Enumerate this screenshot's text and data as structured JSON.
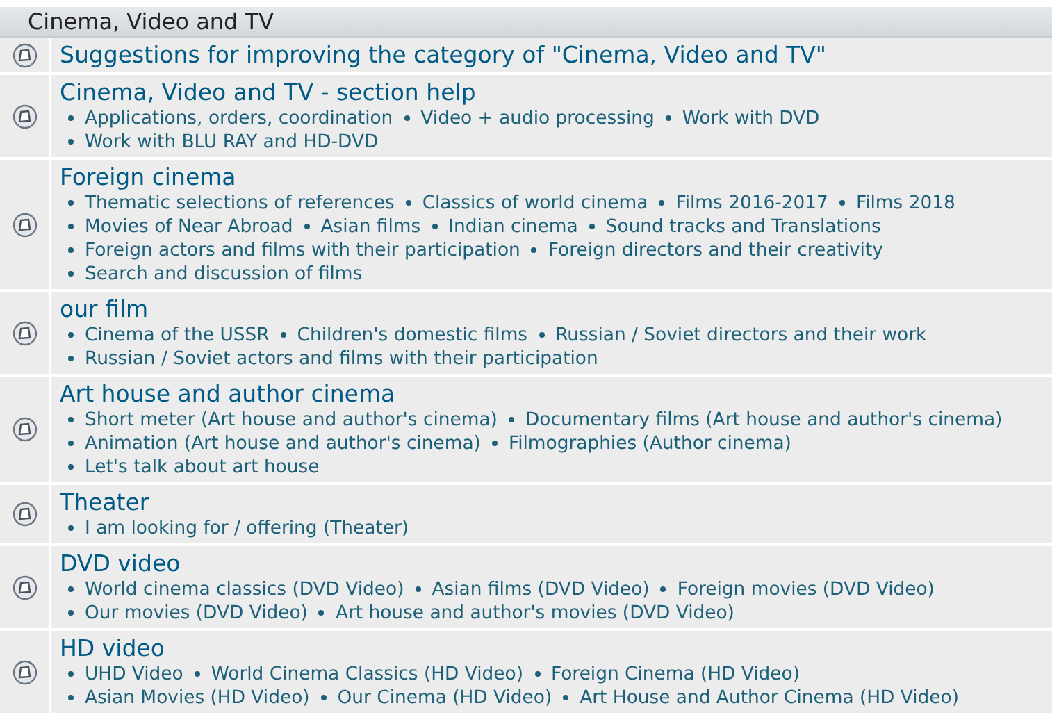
{
  "category": {
    "title": "Cinema, Video and TV"
  },
  "forums": [
    {
      "title": "Suggestions for improving the category of \"Cinema, Video and TV\""
    },
    {
      "title": "Cinema, Video and TV - section help",
      "subforums": [
        "Applications, orders, coordination",
        "Video + audio processing",
        "Work with DVD",
        "Work with BLU RAY and HD-DVD"
      ]
    },
    {
      "title": "Foreign cinema",
      "subforums": [
        "Thematic selections of references",
        "Classics of world cinema",
        "Films 2016-2017",
        "Films 2018",
        "Movies of Near Abroad",
        "Asian films",
        "Indian cinema",
        "Sound tracks and Translations",
        "Foreign actors and films with their participation",
        "Foreign directors and their creativity",
        "Search and discussion of films"
      ]
    },
    {
      "title": "our film",
      "subforums": [
        "Cinema of the USSR",
        "Children's domestic films",
        "Russian / Soviet directors and their work",
        "Russian / Soviet actors and films with their participation"
      ]
    },
    {
      "title": "Art house and author cinema",
      "subforums": [
        "Short meter (Art house and author's cinema)",
        "Documentary films (Art house and author's cinema)",
        "Animation (Art house and author's cinema)",
        "Filmographies (Author cinema)",
        "Let's talk about art house"
      ]
    },
    {
      "title": "Theater",
      "subforums": [
        "I am looking for / offering (Theater)"
      ]
    },
    {
      "title": "DVD video",
      "subforums": [
        "World cinema classics (DVD Video)",
        "Asian films (DVD Video)",
        "Foreign movies (DVD Video)",
        "Our movies (DVD Video)",
        "Art house and author's movies (DVD Video)"
      ]
    },
    {
      "title": "HD video",
      "subforums": [
        "UHD Video",
        "World Cinema Classics (HD Video)",
        "Foreign Cinema (HD Video)",
        "Asian Movies (HD Video)",
        "Our Cinema (HD Video)",
        "Art House and Author Cinema (HD Video)"
      ]
    }
  ]
}
